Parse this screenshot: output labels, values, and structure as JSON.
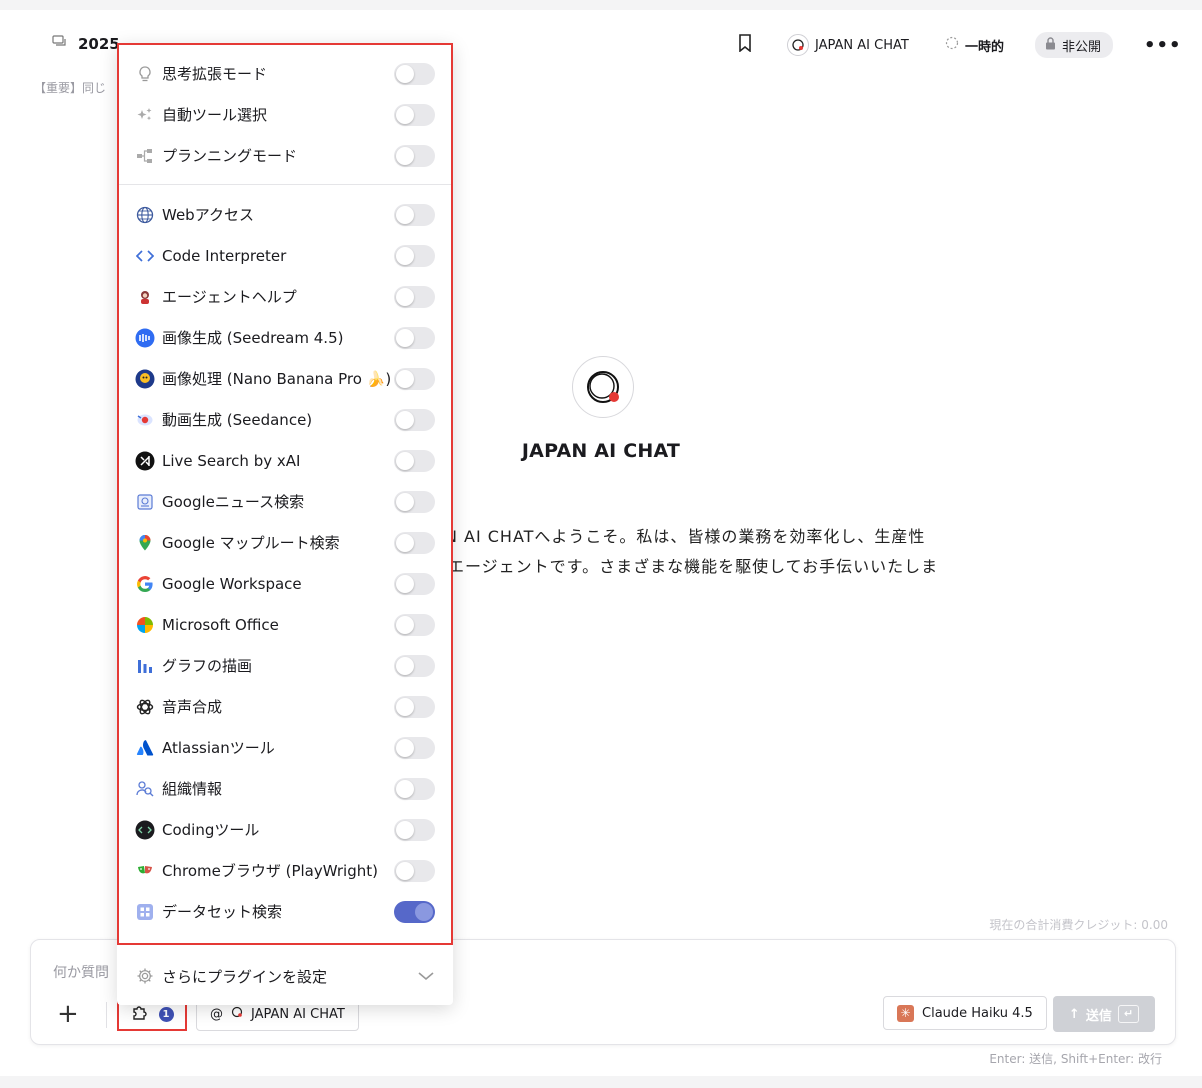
{
  "header": {
    "chat_title": "2025",
    "notice": "【重要】同じ",
    "agent_label": "JAPAN AI CHAT",
    "temporary_label": "一時的",
    "private_label": "非公開"
  },
  "center": {
    "title": "JAPAN AI CHAT",
    "welcome_line1": "AN AI CHATへようこそ。私は、皆様の業務を効率化し、生産性",
    "welcome_line2": "エージェントです。さまざまな機能を駆使してお手伝いいたしま"
  },
  "plugins": {
    "modes": [
      {
        "label": "思考拡張モード",
        "icon": "lightbulb-icon",
        "enabled": false
      },
      {
        "label": "自動ツール選択",
        "icon": "sparkle-icon",
        "enabled": false
      },
      {
        "label": "プランニングモード",
        "icon": "flowchart-icon",
        "enabled": false
      }
    ],
    "tools": [
      {
        "label": "Webアクセス",
        "icon": "globe-icon",
        "enabled": false
      },
      {
        "label": "Code Interpreter",
        "icon": "code-icon",
        "enabled": false
      },
      {
        "label": "エージェントヘルプ",
        "icon": "agent-icon",
        "enabled": false
      },
      {
        "label": "画像生成 (Seedream 4.5)",
        "icon": "seedream-icon",
        "enabled": false
      },
      {
        "label": "画像処理 (Nano Banana Pro 🍌)",
        "icon": "nano-banana-icon",
        "enabled": false
      },
      {
        "label": "動画生成 (Seedance)",
        "icon": "seedance-icon",
        "enabled": false
      },
      {
        "label": "Live Search by xAI",
        "icon": "xai-icon",
        "enabled": false
      },
      {
        "label": "Googleニュース検索",
        "icon": "news-icon",
        "enabled": false
      },
      {
        "label": "Google マップルート検索",
        "icon": "map-pin-icon",
        "enabled": false
      },
      {
        "label": "Google Workspace",
        "icon": "google-icon",
        "enabled": false
      },
      {
        "label": "Microsoft Office",
        "icon": "microsoft-icon",
        "enabled": false
      },
      {
        "label": "グラフの描画",
        "icon": "bar-chart-icon",
        "enabled": false
      },
      {
        "label": "音声合成",
        "icon": "openai-icon",
        "enabled": false
      },
      {
        "label": "Atlassianツール",
        "icon": "atlassian-icon",
        "enabled": false
      },
      {
        "label": "組織情報",
        "icon": "org-search-icon",
        "enabled": false
      },
      {
        "label": "Codingツール",
        "icon": "coding-icon",
        "enabled": false
      },
      {
        "label": "Chromeブラウザ (PlayWright)",
        "icon": "playwright-icon",
        "enabled": false
      },
      {
        "label": "データセット検索",
        "icon": "dataset-icon",
        "enabled": true
      }
    ],
    "more_label": "さらにプラグインを設定"
  },
  "composer": {
    "placeholder": "何か質問",
    "plugin_count": "1",
    "mention_label": "JAPAN AI CHAT",
    "model_label": "Claude Haiku 4.5",
    "send_label": "送信",
    "credits": "現在の合計消費クレジット: 0.00",
    "hint": "Enter: 送信, Shift+Enter: 改行"
  },
  "colors": {
    "accent": "#5668c9",
    "highlight": "#e53935",
    "logo_dot": "#e53935"
  }
}
